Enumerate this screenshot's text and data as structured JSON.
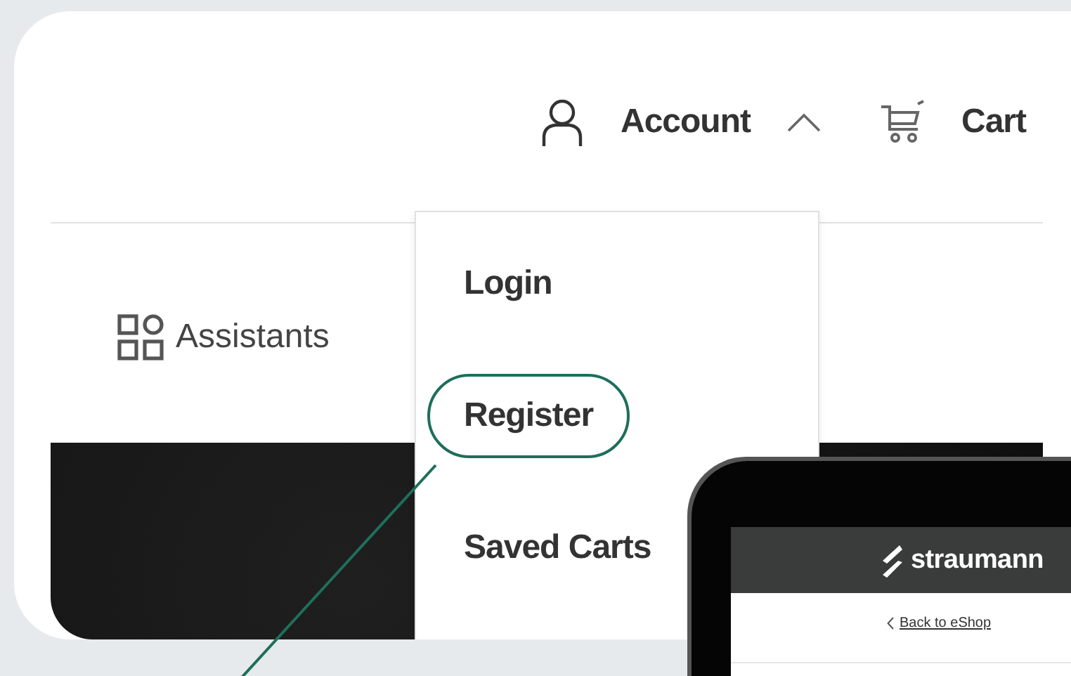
{
  "header": {
    "account": {
      "label": "Account",
      "expanded": true
    },
    "cart": {
      "label": "Cart"
    }
  },
  "nav": {
    "assistants": "Assistants"
  },
  "account_menu": {
    "items": [
      {
        "label": "Login",
        "highlighted": false
      },
      {
        "label": "Register",
        "highlighted": true
      },
      {
        "label": "Saved Carts",
        "highlighted": false
      }
    ]
  },
  "tablet": {
    "brand": "straumann",
    "back_link": "Back to eShop"
  }
}
